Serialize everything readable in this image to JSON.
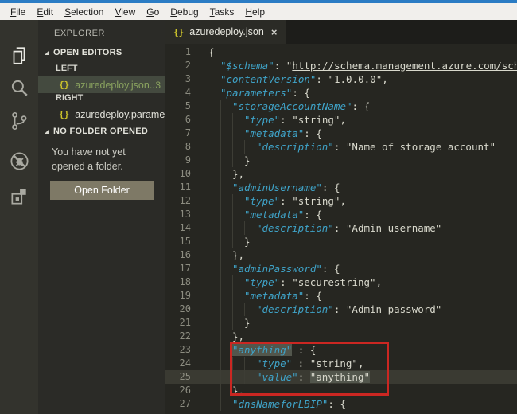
{
  "menubar": {
    "items": [
      "File",
      "Edit",
      "Selection",
      "View",
      "Go",
      "Debug",
      "Tasks",
      "Help"
    ]
  },
  "activity_bar": {
    "icons": [
      "files",
      "search",
      "source-control",
      "debug",
      "extensions"
    ]
  },
  "sidebar": {
    "title": "EXPLORER",
    "open_editors_label": "OPEN EDITORS",
    "groups": [
      {
        "label": "LEFT",
        "items": [
          {
            "icon": "{}",
            "name": "azuredeploy.json...",
            "badge": "3",
            "selected": true
          }
        ]
      },
      {
        "label": "RIGHT",
        "items": [
          {
            "icon": "{}",
            "name": "azuredeploy.paramet...",
            "badge": "",
            "selected": false
          }
        ]
      }
    ],
    "no_folder_label": "NO FOLDER OPENED",
    "no_folder_message": "You have not yet opened a folder.",
    "open_folder_button": "Open Folder"
  },
  "tab": {
    "icon": "{}",
    "title": "azuredeploy.json",
    "close": "×"
  },
  "editor": {
    "file_type": "json",
    "highlighted_word": "anything",
    "annotation": "red box around lines 23-26",
    "lines": [
      {
        "n": "1",
        "i": 0,
        "t": [
          [
            "p",
            "{"
          ]
        ]
      },
      {
        "n": "2",
        "i": 2,
        "t": [
          [
            "k",
            "\"$schema\""
          ],
          [
            "p",
            ": "
          ],
          [
            "s",
            "\""
          ],
          [
            "u",
            "http://schema.management.azure.com/schem"
          ]
        ]
      },
      {
        "n": "3",
        "i": 2,
        "t": [
          [
            "k",
            "\"contentVersion\""
          ],
          [
            "p",
            ": "
          ],
          [
            "s",
            "\"1.0.0.0\""
          ],
          [
            "p",
            ","
          ]
        ]
      },
      {
        "n": "4",
        "i": 2,
        "t": [
          [
            "k",
            "\"parameters\""
          ],
          [
            "p",
            ": {"
          ]
        ]
      },
      {
        "n": "5",
        "i": 4,
        "t": [
          [
            "k",
            "\"storageAccountName\""
          ],
          [
            "p",
            ": {"
          ]
        ]
      },
      {
        "n": "6",
        "i": 6,
        "t": [
          [
            "k",
            "\"type\""
          ],
          [
            "p",
            ": "
          ],
          [
            "s",
            "\"string\""
          ],
          [
            "p",
            ","
          ]
        ]
      },
      {
        "n": "7",
        "i": 6,
        "t": [
          [
            "k",
            "\"metadata\""
          ],
          [
            "p",
            ": {"
          ]
        ]
      },
      {
        "n": "8",
        "i": 8,
        "t": [
          [
            "k",
            "\"description\""
          ],
          [
            "p",
            ": "
          ],
          [
            "s",
            "\"Name of storage account\""
          ]
        ]
      },
      {
        "n": "9",
        "i": 6,
        "t": [
          [
            "p",
            "}"
          ]
        ]
      },
      {
        "n": "10",
        "i": 4,
        "t": [
          [
            "p",
            "},"
          ]
        ]
      },
      {
        "n": "11",
        "i": 4,
        "t": [
          [
            "k",
            "\"adminUsername\""
          ],
          [
            "p",
            ": {"
          ]
        ]
      },
      {
        "n": "12",
        "i": 6,
        "t": [
          [
            "k",
            "\"type\""
          ],
          [
            "p",
            ": "
          ],
          [
            "s",
            "\"string\""
          ],
          [
            "p",
            ","
          ]
        ]
      },
      {
        "n": "13",
        "i": 6,
        "t": [
          [
            "k",
            "\"metadata\""
          ],
          [
            "p",
            ": {"
          ]
        ]
      },
      {
        "n": "14",
        "i": 8,
        "t": [
          [
            "k",
            "\"description\""
          ],
          [
            "p",
            ": "
          ],
          [
            "s",
            "\"Admin username\""
          ]
        ]
      },
      {
        "n": "15",
        "i": 6,
        "t": [
          [
            "p",
            "}"
          ]
        ]
      },
      {
        "n": "16",
        "i": 4,
        "t": [
          [
            "p",
            "},"
          ]
        ]
      },
      {
        "n": "17",
        "i": 4,
        "t": [
          [
            "k",
            "\"adminPassword\""
          ],
          [
            "p",
            ": {"
          ]
        ]
      },
      {
        "n": "18",
        "i": 6,
        "t": [
          [
            "k",
            "\"type\""
          ],
          [
            "p",
            ": "
          ],
          [
            "s",
            "\"securestring\""
          ],
          [
            "p",
            ","
          ]
        ]
      },
      {
        "n": "19",
        "i": 6,
        "t": [
          [
            "k",
            "\"metadata\""
          ],
          [
            "p",
            ": {"
          ]
        ]
      },
      {
        "n": "20",
        "i": 8,
        "t": [
          [
            "k",
            "\"description\""
          ],
          [
            "p",
            ": "
          ],
          [
            "s",
            "\"Admin password\""
          ]
        ]
      },
      {
        "n": "21",
        "i": 6,
        "t": [
          [
            "p",
            "}"
          ]
        ]
      },
      {
        "n": "22",
        "i": 4,
        "t": [
          [
            "p",
            "},"
          ]
        ]
      },
      {
        "n": "23",
        "i": 4,
        "t": [
          [
            "hk",
            "\"anything\""
          ],
          [
            "p",
            " : {"
          ]
        ]
      },
      {
        "n": "24",
        "i": 8,
        "t": [
          [
            "k",
            "\"type\""
          ],
          [
            "p",
            " : "
          ],
          [
            "s",
            "\"string\""
          ],
          [
            "p",
            ","
          ]
        ]
      },
      {
        "n": "25",
        "i": 8,
        "cur": true,
        "t": [
          [
            "k",
            "\"value\""
          ],
          [
            "p",
            ": "
          ],
          [
            "hs",
            "\"anything\""
          ]
        ]
      },
      {
        "n": "26",
        "i": 4,
        "t": [
          [
            "p",
            "},"
          ]
        ]
      },
      {
        "n": "27",
        "i": 4,
        "t": [
          [
            "k",
            "\"dnsNameforLBIP\""
          ],
          [
            "p",
            ": {"
          ]
        ]
      }
    ]
  },
  "colors": {
    "titlebar_blue": "#2b7cc4",
    "menubar_bg": "#f1efec",
    "activitybar_bg": "#33332d",
    "sidebar_bg": "#2b2b27",
    "editor_bg": "#262621",
    "key_color": "#3fa3c8",
    "string_color": "#d8d8cc",
    "selected_item_text": "#8aa35f",
    "brace_icon_yellow": "#cdc42b",
    "open_folder_button_bg": "#7e7966",
    "current_line_bg": "#3a3a32",
    "occurrence_highlight_bg": "#52564c",
    "annotation_red": "#cb2722"
  }
}
